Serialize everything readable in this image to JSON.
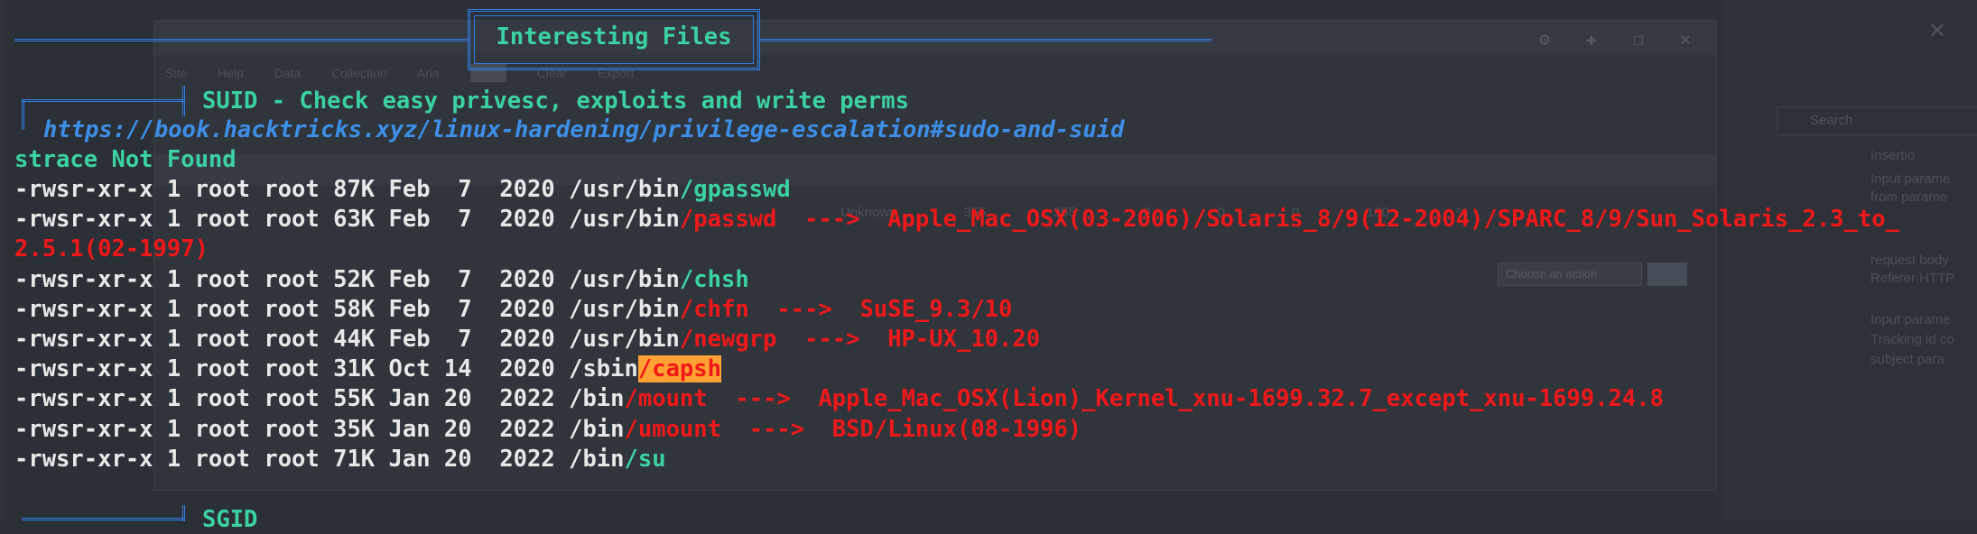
{
  "background_window": {
    "toolbar_items": [
      "Site",
      "Help",
      "Data Collection",
      "Aria",
      "OK",
      "Clear",
      "Export"
    ],
    "row_values": [
      "Unknown",
      "355",
      "355",
      "0",
      "0",
      "0",
      "100 %"
    ],
    "action_select": "Choose an action",
    "right_panel": {
      "search_placeholder": "Search",
      "lines": [
        "Insertio",
        "Input parame",
        "from parame",
        "request body",
        "Referer HTTP",
        "Input parame",
        "Tracking id co",
        "subject para"
      ]
    }
  },
  "terminal": {
    "banner_title": "Interesting Files",
    "section_title": "SUID - Check easy privesc, exploits and write perms",
    "section_link": "https://book.hacktricks.xyz/linux-hardening/privilege-escalation#sudo-and-suid",
    "status_line": "strace Not Found",
    "files": [
      {
        "perms": "-rwsr-xr-x",
        "links": "1",
        "owner": "root",
        "group": "root",
        "size": "87K",
        "month": "Feb",
        "day": " 7",
        "year": "2020",
        "dir": "/usr/bin",
        "name": "/gpasswd",
        "style": "green",
        "exploit": ""
      },
      {
        "perms": "-rwsr-xr-x",
        "links": "1",
        "owner": "root",
        "group": "root",
        "size": "63K",
        "month": "Feb",
        "day": " 7",
        "year": "2020",
        "dir": "/usr/bin",
        "name": "/passwd",
        "style": "red",
        "exploit": "Apple_Mac_OSX(03-2006)/Solaris_8/9(12-2004)/SPARC_8/9/Sun_Solaris_2.3_to_",
        "exploit_cont": "2.5.1(02-1997)"
      },
      {
        "perms": "-rwsr-xr-x",
        "links": "1",
        "owner": "root",
        "group": "root",
        "size": "52K",
        "month": "Feb",
        "day": " 7",
        "year": "2020",
        "dir": "/usr/bin",
        "name": "/chsh",
        "style": "green",
        "exploit": ""
      },
      {
        "perms": "-rwsr-xr-x",
        "links": "1",
        "owner": "root",
        "group": "root",
        "size": "58K",
        "month": "Feb",
        "day": " 7",
        "year": "2020",
        "dir": "/usr/bin",
        "name": "/chfn",
        "style": "red",
        "exploit": "SuSE_9.3/10"
      },
      {
        "perms": "-rwsr-xr-x",
        "links": "1",
        "owner": "root",
        "group": "root",
        "size": "44K",
        "month": "Feb",
        "day": " 7",
        "year": "2020",
        "dir": "/usr/bin",
        "name": "/newgrp",
        "style": "red",
        "exploit": "HP-UX_10.20"
      },
      {
        "perms": "-rwsr-xr-x",
        "links": "1",
        "owner": "root",
        "group": "root",
        "size": "31K",
        "month": "Oct",
        "day": "14",
        "year": "2020",
        "dir": "/sbin",
        "name": "/capsh",
        "style": "highlight",
        "exploit": ""
      },
      {
        "perms": "-rwsr-xr-x",
        "links": "1",
        "owner": "root",
        "group": "root",
        "size": "55K",
        "month": "Jan",
        "day": "20",
        "year": "2022",
        "dir": "/bin",
        "name": "/mount",
        "style": "red",
        "exploit": "Apple_Mac_OSX(Lion)_Kernel_xnu-1699.32.7_except_xnu-1699.24.8"
      },
      {
        "perms": "-rwsr-xr-x",
        "links": "1",
        "owner": "root",
        "group": "root",
        "size": "35K",
        "month": "Jan",
        "day": "20",
        "year": "2022",
        "dir": "/bin",
        "name": "/umount",
        "style": "red",
        "exploit": "BSD/Linux(08-1996)"
      },
      {
        "perms": "-rwsr-xr-x",
        "links": "1",
        "owner": "root",
        "group": "root",
        "size": "71K",
        "month": "Jan",
        "day": "20",
        "year": "2022",
        "dir": "/bin",
        "name": "/su",
        "style": "green",
        "exploit": ""
      }
    ],
    "arrow": "--->",
    "next_section_title": "SGID"
  }
}
